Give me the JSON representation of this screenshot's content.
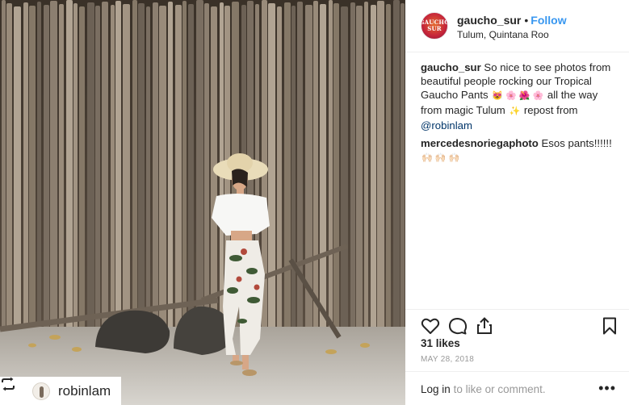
{
  "post": {
    "username": "gaucho_sur",
    "follow_label": "Follow",
    "separator": "•",
    "location": "Tulum, Quintana Roo",
    "avatar_text_line1": "GAUCHO",
    "avatar_text_line2": "SUR"
  },
  "repost_tag": {
    "username": "robinlam",
    "icon": "repost-icon"
  },
  "comments": [
    {
      "user": "gaucho_sur",
      "text_1": "So nice to see photos from beautiful people rocking our Tropical Gaucho Pants",
      "emoji_1": "😻 🌸 🌺 🌸",
      "text_2": "all the way from magic Tulum",
      "emoji_2": "✨",
      "text_3": "repost from",
      "mention": "@robinlam"
    },
    {
      "user": "mercedesnoriegaphoto",
      "text_1": "Esos pants!!!!!!",
      "emoji_1": "🙌🏻 🙌🏻 🙌🏻"
    }
  ],
  "actions": {
    "icons": [
      "heart-icon",
      "comment-icon",
      "share-icon",
      "bookmark-icon"
    ]
  },
  "likes": "31 likes",
  "date": "MAY 28, 2018",
  "login": {
    "link": "Log in",
    "text": "to like or comment.",
    "more": "•••"
  },
  "colors": {
    "link_blue": "#3897f0",
    "mention": "#003569",
    "muted": "#999999",
    "text": "#262626"
  }
}
